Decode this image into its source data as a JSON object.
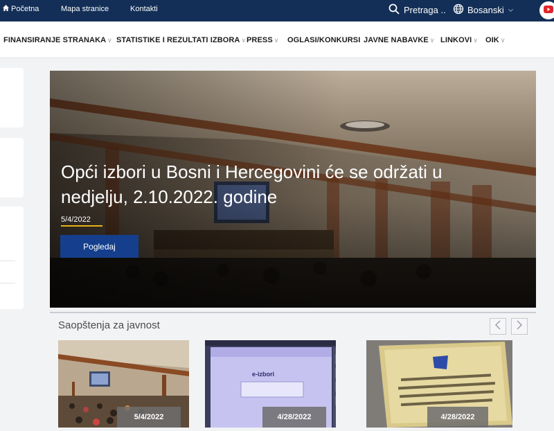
{
  "topbar": {
    "home_label": "Početna",
    "sitemap_label": "Mapa stranice",
    "contacts_label": "Kontakti",
    "search_label": "Pretraga ..",
    "language_label": "Bosanski",
    "icons": [
      "home-icon",
      "search-icon",
      "globe-icon",
      "chevron-down-icon",
      "youtube-icon"
    ]
  },
  "nav": {
    "items": [
      {
        "label": "FINANSIRANJE STRANAKA"
      },
      {
        "label": "STATISTIKE I REZULTATI IZBORA"
      },
      {
        "label": "PRESS"
      },
      {
        "label": "OGLASI/KONKURSI"
      },
      {
        "label": "JAVNE NABAVKE"
      },
      {
        "label": "LINKOVI"
      },
      {
        "label": "OIK"
      }
    ]
  },
  "hero": {
    "title": "Opći izbori u Bosni i Hercegovini će se održati u nedjelju, 2.10.2022. godine",
    "date": "5/4/2022",
    "button_label": "Pogledaj",
    "accent_color": "#e9b115",
    "button_color": "#153f8c"
  },
  "news": {
    "section_title": "Saopštenja za javnost",
    "prev_icon": "chevron-left-icon",
    "next_icon": "chevron-right-icon",
    "cards": [
      {
        "date": "5/4/2022"
      },
      {
        "date": "4/28/2022"
      },
      {
        "date": "4/28/2022"
      }
    ]
  },
  "colors": {
    "topbar_bg": "#132f57",
    "youtube_red": "#e0262b"
  }
}
